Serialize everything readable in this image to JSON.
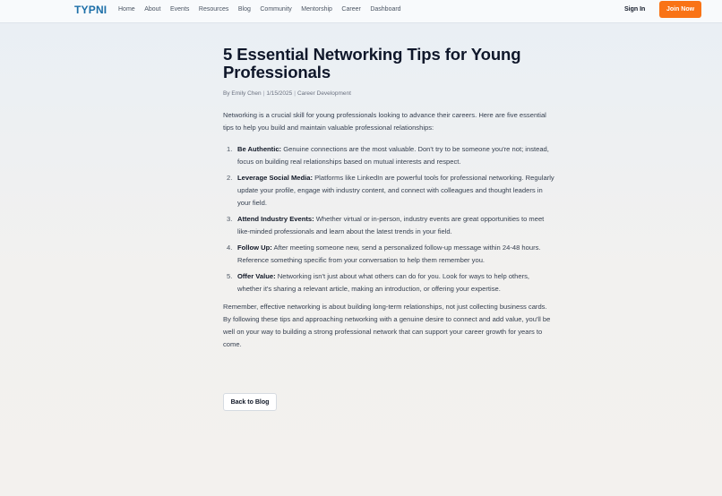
{
  "header": {
    "logo": "TYPNI",
    "nav": [
      "Home",
      "About",
      "Events",
      "Resources",
      "Blog",
      "Community",
      "Mentorship",
      "Career",
      "Dashboard"
    ],
    "sign_in": "Sign In",
    "join": "Join Now",
    "accent_color": "#f97316",
    "brand_color": "#1d6fa8"
  },
  "article": {
    "title": "5 Essential Networking Tips for Young Professionals",
    "author": "By Emily Chen",
    "date": "1/15/2025",
    "category": "Career Development",
    "intro": "Networking is a crucial skill for young professionals looking to advance their careers. Here are five essential tips to help you build and maintain valuable professional relationships:",
    "tips": [
      {
        "num": "1.",
        "heading": "Be Authentic:",
        "text": " Genuine connections are the most valuable. Don't try to be someone you're not; instead, focus on building real relationships based on mutual interests and respect."
      },
      {
        "num": "2.",
        "heading": "Leverage Social Media:",
        "text": " Platforms like LinkedIn are powerful tools for professional networking. Regularly update your profile, engage with industry content, and connect with colleagues and thought leaders in your field."
      },
      {
        "num": "3.",
        "heading": "Attend Industry Events:",
        "text": " Whether virtual or in-person, industry events are great opportunities to meet like-minded professionals and learn about the latest trends in your field."
      },
      {
        "num": "4.",
        "heading": "Follow Up:",
        "text": " After meeting someone new, send a personalized follow-up message within 24-48 hours. Reference something specific from your conversation to help them remember you."
      },
      {
        "num": "5.",
        "heading": "Offer Value:",
        "text": " Networking isn't just about what others can do for you. Look for ways to help others, whether it's sharing a relevant article, making an introduction, or offering your expertise."
      }
    ],
    "outro": "Remember, effective networking is about building long-term relationships, not just collecting business cards. By following these tips and approaching networking with a genuine desire to connect and add value, you'll be well on your way to building a strong professional network that can support your career growth for years to come.",
    "back_label": "Back to Blog"
  }
}
